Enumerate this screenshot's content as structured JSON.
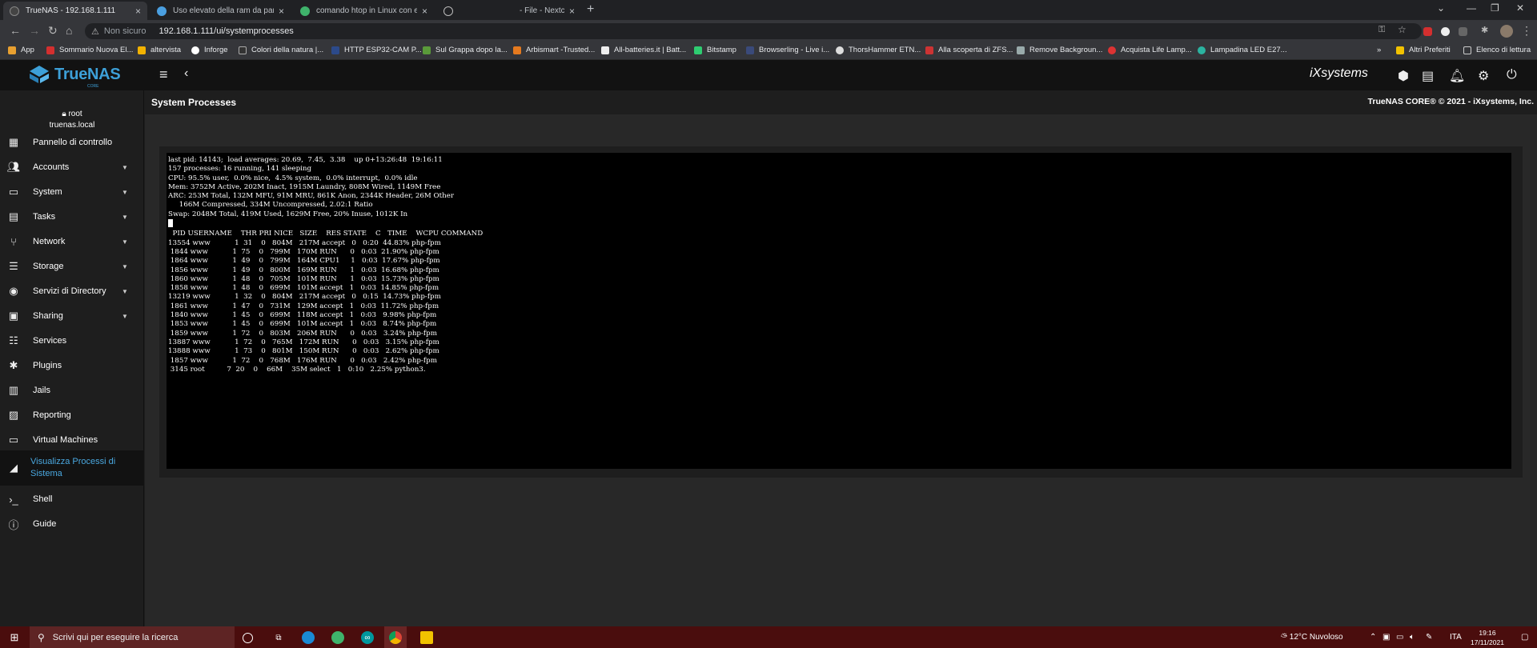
{
  "browser": {
    "tabs": [
      {
        "title": "TrueNAS - 192.168.1.111",
        "active": true
      },
      {
        "title": "Uso elevato della ram da parte d",
        "active": false
      },
      {
        "title": "comando htop in Linux con esem",
        "active": false
      },
      {
        "title": "- File - Nextclo",
        "active": false
      }
    ],
    "omnibox": {
      "security": "Non sicuro",
      "url": "192.168.1.111/ui/systemprocesses"
    },
    "bookmarks": [
      "App",
      "Sommario Nuova El...",
      "altervista",
      "Inforge",
      "Colori della natura |...",
      "HTTP ESP32-CAM P...",
      "Sul Grappa dopo la...",
      "Arbismart -Trusted...",
      "All-batteries.it | Batt...",
      "Bitstamp",
      "Browserling - Live i...",
      "ThorsHammer ETN...",
      "Alla scoperta di ZFS...",
      "Remove Backgroun...",
      "Acquista Life Lamp...",
      "Lampadina LED E27..."
    ],
    "bookmark_overflow": "»",
    "other_bookmarks": "Altri Preferiti",
    "reading_list": "Elenco di lettura"
  },
  "app": {
    "logo_name": "TrueNAS",
    "logo_sub": "CORE",
    "vendor": "iXsystems",
    "page_title": "System Processes",
    "copyright": "TrueNAS CORE® © 2021 - iXsystems, Inc.",
    "user": {
      "name": "root",
      "host": "truenas.local"
    }
  },
  "sidebar": {
    "items": [
      {
        "label": "Pannello di controllo",
        "icon": "dashboard-icon",
        "expandable": false
      },
      {
        "label": "Accounts",
        "icon": "people-icon",
        "expandable": true
      },
      {
        "label": "System",
        "icon": "laptop-icon",
        "expandable": true
      },
      {
        "label": "Tasks",
        "icon": "calendar-icon",
        "expandable": true
      },
      {
        "label": "Network",
        "icon": "network-icon",
        "expandable": true
      },
      {
        "label": "Storage",
        "icon": "storage-icon",
        "expandable": true
      },
      {
        "label": "Servizi di Directory",
        "icon": "directory-icon",
        "expandable": true
      },
      {
        "label": "Sharing",
        "icon": "sharing-icon",
        "expandable": true
      },
      {
        "label": "Services",
        "icon": "tune-icon",
        "expandable": false
      },
      {
        "label": "Plugins",
        "icon": "puzzle-icon",
        "expandable": false
      },
      {
        "label": "Jails",
        "icon": "jail-icon",
        "expandable": false
      },
      {
        "label": "Reporting",
        "icon": "chart-icon",
        "expandable": false
      },
      {
        "label": "Virtual Machines",
        "icon": "monitor-icon",
        "expandable": false
      },
      {
        "label": "Visualizza Processi di Sistema",
        "icon": "process-icon",
        "expandable": false,
        "active": true
      },
      {
        "label": "Shell",
        "icon": "terminal-icon",
        "expandable": false
      },
      {
        "label": "Guide",
        "icon": "info-icon",
        "expandable": false
      }
    ]
  },
  "terminal": {
    "lines": [
      "last pid: 14143;  load averages: 20.69,  7.45,  3.38    up 0+13:26:48  19:16:11",
      "157 processes: 16 running, 141 sleeping",
      "CPU: 95.5% user,  0.0% nice,  4.5% system,  0.0% interrupt,  0.0% idle",
      "Mem: 3752M Active, 202M Inact, 1915M Laundry, 808M Wired, 1149M Free",
      "ARC: 253M Total, 132M MFU, 91M MRU, 861K Anon, 2344K Header, 26M Other",
      "     166M Compressed, 334M Uncompressed, 2.02:1 Ratio",
      "Swap: 2048M Total, 419M Used, 1629M Free, 20% Inuse, 1012K In"
    ],
    "header": "  PID USERNAME    THR PRI NICE   SIZE    RES STATE    C   TIME    WCPU COMMAND",
    "processes": [
      "13554 www           1  31    0   804M   217M accept   0   0:20  44.83% php-fpm",
      " 1844 www           1  75    0   799M   170M RUN      0   0:03  21.90% php-fpm",
      " 1864 www           1  49    0   799M   164M CPU1     1   0:03  17.67% php-fpm",
      " 1856 www           1  49    0   800M   169M RUN      1   0:03  16.68% php-fpm",
      " 1860 www           1  48    0   705M   101M RUN      1   0:03  15.73% php-fpm",
      " 1858 www           1  48    0   699M   101M accept   1   0:03  14.85% php-fpm",
      "13219 www           1  32    0   804M   217M accept   0   0:15  14.73% php-fpm",
      " 1861 www           1  47    0   731M   129M accept   1   0:03  11.72% php-fpm",
      " 1840 www           1  45    0   699M   118M accept   1   0:03   9.98% php-fpm",
      " 1853 www           1  45    0   699M   101M accept   1   0:03   8.74% php-fpm",
      " 1859 www           1  72    0   803M   206M RUN      0   0:03   3.24% php-fpm",
      "13887 www           1  72    0   765M   172M RUN      0   0:03   3.15% php-fpm",
      "13888 www           1  73    0   801M   150M RUN      0   0:03   2.62% php-fpm",
      " 1857 www           1  72    0   768M   176M RUN      0   0:03   2.42% php-fpm",
      " 3145 root          7  20    0    66M    35M select   1   0:10   2.25% python3."
    ]
  },
  "taskbar": {
    "search_placeholder": "Scrivi qui per eseguire la ricerca",
    "weather": "12°C  Nuvoloso",
    "language": "ITA",
    "time": "19:16",
    "date": "17/11/2021"
  },
  "colors": {
    "accent": "#3da0d8",
    "taskbar": "#4a0d0d",
    "terminal_bg": "#000000"
  }
}
